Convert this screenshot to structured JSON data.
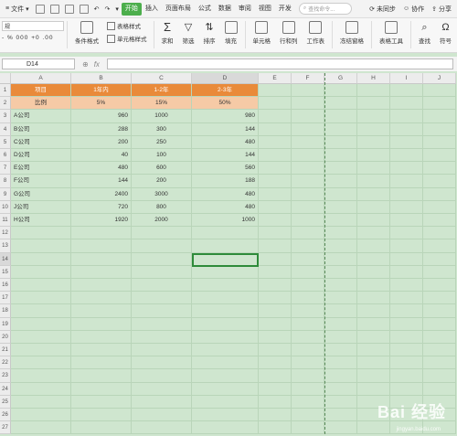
{
  "menubar": {
    "file_label": "文件",
    "tabs": [
      "开始",
      "插入",
      "页面布局",
      "公式",
      "数据",
      "审阅",
      "视图",
      "开发"
    ],
    "active_tab": "开始",
    "search_placeholder": "查找命令...",
    "sync": "未同步",
    "collab": "协作",
    "share": "分享"
  },
  "ribbon": {
    "font_name": "规",
    "format_row": "- % 000 +0 .00",
    "cond_format": "条件格式",
    "table_style": "表格样式",
    "cell_style": "单元格样式",
    "sum": "求和",
    "filter": "筛选",
    "sort": "排序",
    "fill": "填充",
    "cell": "单元格",
    "rowcol": "行和列",
    "worksheet": "工作表",
    "freeze": "冻结窗格",
    "table_tools": "表格工具",
    "find": "查找",
    "symbol": "符号"
  },
  "formula": {
    "cell_ref": "D14",
    "fx": "fx",
    "value": ""
  },
  "columns": [
    "A",
    "B",
    "C",
    "D",
    "E",
    "F",
    "G",
    "H",
    "I",
    "J"
  ],
  "selected_column": "D",
  "selected_row": "14",
  "rows": [
    "1",
    "2",
    "3",
    "4",
    "5",
    "6",
    "7",
    "8",
    "9",
    "10",
    "11",
    "12",
    "13",
    "14",
    "15",
    "16",
    "17",
    "18",
    "19",
    "20",
    "21",
    "22",
    "23",
    "24",
    "25",
    "26",
    "27"
  ],
  "table": {
    "header": [
      "项目",
      "1年内",
      "1-2年",
      "2-3年"
    ],
    "ratio": [
      "比例",
      "5%",
      "15%",
      "50%"
    ],
    "data": [
      [
        "A公司",
        "960",
        "1000",
        "980"
      ],
      [
        "B公司",
        "288",
        "300",
        "144"
      ],
      [
        "C公司",
        "200",
        "250",
        "480"
      ],
      [
        "D公司",
        "40",
        "100",
        "144"
      ],
      [
        "E公司",
        "480",
        "600",
        "560"
      ],
      [
        "F公司",
        "144",
        "200",
        "188"
      ],
      [
        "G公司",
        "2400",
        "3000",
        "480"
      ],
      [
        "J公司",
        "720",
        "800",
        "480"
      ],
      [
        "H公司",
        "1920",
        "2000",
        "1000"
      ]
    ]
  },
  "colors": {
    "header_bg": "#e98a3a",
    "ratio_bg": "#f6caa6",
    "sheet_bg": "#cfe6cf",
    "active_tab": "#4cae4c"
  },
  "watermark": {
    "brand": "Bai 经验",
    "url": "jingyan.baidu.com"
  }
}
